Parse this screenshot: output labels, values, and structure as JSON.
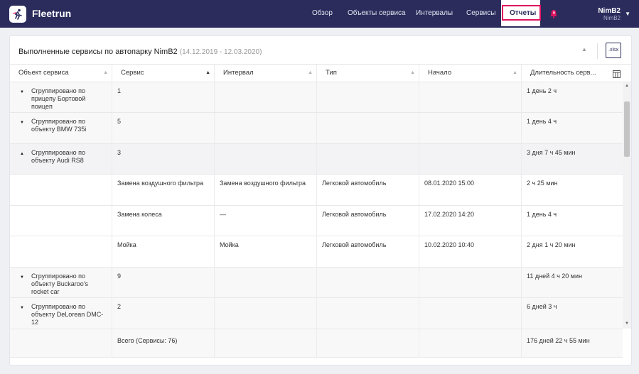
{
  "app": {
    "brand": "Fleetrun",
    "nav": [
      {
        "label": "Обзор"
      },
      {
        "label": "Объекты сервиса"
      },
      {
        "label": "Интервалы"
      },
      {
        "label": "Сервисы"
      },
      {
        "label": "Отчеты",
        "active": true
      }
    ],
    "notifications_count": "6",
    "user": {
      "name": "NimB2",
      "account": "NimB2"
    }
  },
  "report": {
    "title": "Выполненные сервисы по автопарку NimB2",
    "period": "(14.12.2019 - 12.03.2020)",
    "export_label": ".xlsx",
    "columns": [
      {
        "label": "Объект сервиса"
      },
      {
        "label": "Сервис"
      },
      {
        "label": "Интервал"
      },
      {
        "label": "Тип"
      },
      {
        "label": "Начало"
      },
      {
        "label": "Длительность серв..."
      }
    ],
    "rows": [
      {
        "kind": "group",
        "expanded": false,
        "object": "Сгруппировано по прицепу Бортовой поицеп",
        "service": "1",
        "interval": "",
        "type": "",
        "start": "",
        "duration": "1 день 2 ч"
      },
      {
        "kind": "group",
        "expanded": false,
        "object": "Сгруппировано по объекту BMW 735i",
        "service": "5",
        "interval": "",
        "type": "",
        "start": "",
        "duration": "1 день 4 ч"
      },
      {
        "kind": "group",
        "expanded": true,
        "object": "Сгруппировано по объекту Audi RS8",
        "service": "3",
        "interval": "",
        "type": "",
        "start": "",
        "duration": "3 дня 7 ч 45 мин"
      },
      {
        "kind": "detail",
        "object": "",
        "service": "Замена воздушного фильтра",
        "interval": "Замена воздушного фильтра",
        "type": "Легковой автомобиль",
        "start": "08.01.2020 15:00",
        "duration": "2 ч 25 мин"
      },
      {
        "kind": "detail",
        "object": "",
        "service": "Замена колеса",
        "interval": "—",
        "type": "Легковой автомобиль",
        "start": "17.02.2020 14:20",
        "duration": "1 день 4 ч"
      },
      {
        "kind": "detail",
        "object": "",
        "service": "Мойка",
        "interval": "Мойка",
        "type": "Легковой автомобиль",
        "start": "10.02.2020 10:40",
        "duration": "2 дня 1 ч 20 мин"
      },
      {
        "kind": "group",
        "expanded": false,
        "object": "Сгруппировано по объекту Buckaroo's rocket car",
        "service": "9",
        "interval": "",
        "type": "",
        "start": "",
        "duration": "11 дней 4 ч 20 мин"
      },
      {
        "kind": "group",
        "expanded": false,
        "object": "Сгруппировано по объекту DeLorean DMC-12",
        "service": "2",
        "interval": "",
        "type": "",
        "start": "",
        "duration": "6 дней 3 ч"
      }
    ],
    "total": {
      "service": "Всего (Сервисы: 76)",
      "duration": "176 дней 22 ч 55 мин"
    }
  }
}
